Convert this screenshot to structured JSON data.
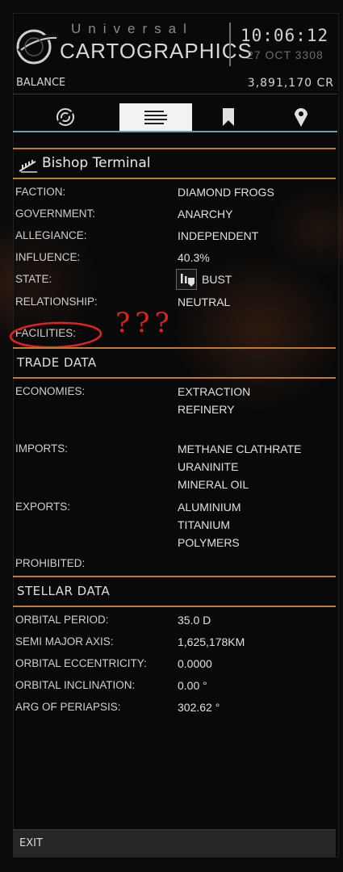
{
  "header": {
    "title_top": "Universal",
    "title_main": "CARTOGRAPHICS",
    "time": "10:06:12",
    "date": "27 OCT 3308"
  },
  "balance": {
    "label": "BALANCE",
    "value": "3,891,170 CR"
  },
  "tabs": [
    {
      "icon": "galaxy-icon",
      "active": false
    },
    {
      "icon": "list-icon",
      "active": true
    },
    {
      "icon": "bookmark-icon",
      "active": false
    },
    {
      "icon": "location-pin-icon",
      "active": false
    }
  ],
  "station": {
    "name": "Bishop Terminal",
    "icon": "outpost-icon"
  },
  "info": {
    "faction": {
      "label": "FACTION:",
      "value": "DIAMOND FROGS"
    },
    "government": {
      "label": "GOVERNMENT:",
      "value": "ANARCHY"
    },
    "allegiance": {
      "label": "ALLEGIANCE:",
      "value": "INDEPENDENT"
    },
    "influence": {
      "label": "INFLUENCE:",
      "value": "40.3%"
    },
    "state": {
      "label": "STATE:",
      "value": "BUST",
      "icon": "bust-state-icon"
    },
    "relationship": {
      "label": "RELATIONSHIP:",
      "value": "NEUTRAL"
    },
    "facilities": {
      "label": "FACILITIES:"
    }
  },
  "annotation": {
    "text": "???",
    "color": "#e0231c"
  },
  "trade": {
    "title": "TRADE DATA",
    "economies": {
      "label": "ECONOMIES:",
      "values": [
        "EXTRACTION",
        "REFINERY"
      ]
    },
    "imports": {
      "label": "IMPORTS:",
      "values": [
        "METHANE CLATHRATE",
        "URANINITE",
        "MINERAL OIL"
      ]
    },
    "exports": {
      "label": "EXPORTS:",
      "values": [
        "ALUMINIUM",
        "TITANIUM",
        "POLYMERS"
      ]
    },
    "prohibited": {
      "label": "PROHIBITED:"
    }
  },
  "stellar": {
    "title": "STELLAR DATA",
    "orbital_period": {
      "label": "ORBITAL PERIOD:",
      "value": "35.0 D"
    },
    "semi_major_axis": {
      "label": "SEMI MAJOR AXIS:",
      "value": "1,625,178KM"
    },
    "eccentricity": {
      "label": "ORBITAL ECCENTRICITY:",
      "value": "0.0000"
    },
    "inclination": {
      "label": "ORBITAL INCLINATION:",
      "value": "0.00 °"
    },
    "periapsis": {
      "label": "ARG OF PERIAPSIS:",
      "value": "302.62 °"
    }
  },
  "footer": {
    "exit_label": "EXIT"
  },
  "colors": {
    "accent": "#c27a2a",
    "tab_underline": "#6aa0a4",
    "annotation": "#e0231c"
  }
}
